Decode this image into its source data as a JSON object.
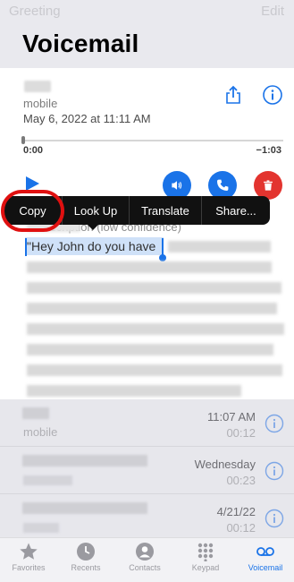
{
  "nav": {
    "back_label": "Greeting",
    "edit_label": "Edit"
  },
  "title": "Voicemail",
  "voicemail": {
    "caller_label": "mobile",
    "datetime": "May 6, 2022 at 11:11 AM",
    "time_start": "0:00",
    "time_end": "−1:03",
    "progress_fraction": 0.0
  },
  "context_menu": {
    "items": [
      "Copy",
      "Look Up",
      "Translate",
      "Share..."
    ]
  },
  "transcript": {
    "header": "Transcription (low confidence)",
    "selected_text": "\"Hey John do you have"
  },
  "list": {
    "rows": [
      {
        "subtitle": "mobile",
        "time": "11:07 AM",
        "duration": "00:12"
      },
      {
        "subtitle": "",
        "time": "Wednesday",
        "duration": "00:23"
      },
      {
        "subtitle": "",
        "time": "4/21/22",
        "duration": "00:12"
      }
    ]
  },
  "tabbar": {
    "items": [
      {
        "label": "Favorites",
        "icon": "star-icon",
        "active": false
      },
      {
        "label": "Recents",
        "icon": "clock-icon",
        "active": false
      },
      {
        "label": "Contacts",
        "icon": "person-icon",
        "active": false
      },
      {
        "label": "Keypad",
        "icon": "keypad-icon",
        "active": false
      },
      {
        "label": "Voicemail",
        "icon": "voicemail-icon",
        "active": true
      }
    ]
  },
  "colors": {
    "accent": "#1a73e8",
    "delete": "#e3342f",
    "highlight": "#e01010"
  }
}
